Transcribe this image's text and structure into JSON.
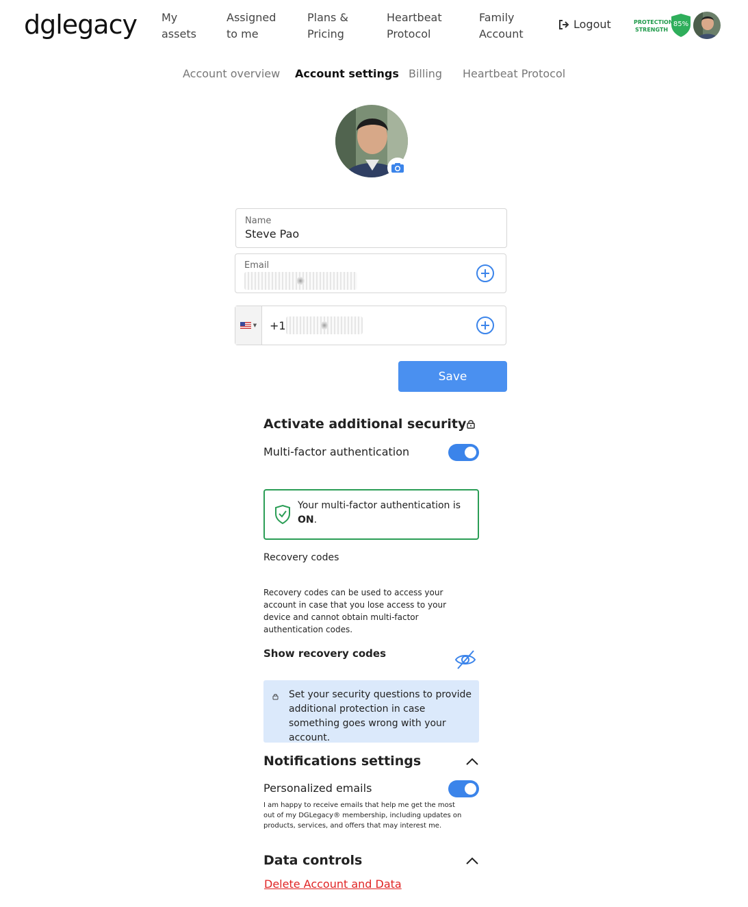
{
  "brand": {
    "logo_text": "dglegacy"
  },
  "nav": {
    "items": [
      {
        "line1": "My",
        "line2": "assets"
      },
      {
        "line1": "Assigned",
        "line2": "to me"
      },
      {
        "line1": "Plans &",
        "line2": "Pricing"
      },
      {
        "line1": "Heartbeat",
        "line2": "Protocol"
      },
      {
        "line1": "Family",
        "line2": "Account"
      }
    ],
    "logout_label": "Logout",
    "protection_line1": "PROTECTION",
    "protection_line2": "STRENGTH",
    "protection_value": "85%"
  },
  "subnav": {
    "tabs": [
      {
        "label": "Account overview",
        "active": false
      },
      {
        "label": "Account settings",
        "active": true
      },
      {
        "label": "Billing",
        "active": false
      },
      {
        "label": "Heartbeat Protocol",
        "active": false
      }
    ]
  },
  "form": {
    "name_label": "Name",
    "name_value": "Steve Pao",
    "email_label": "Email",
    "phone_prefix": "+1",
    "save_label": "Save"
  },
  "security": {
    "title": "Activate additional security",
    "mfa_label": "Multi-factor authentication",
    "mfa_enabled": true,
    "mfa_status_text": "Your multi-factor authentication is",
    "mfa_status_value": "ON",
    "mfa_status_suffix": ".",
    "recovery_title": "Recovery codes",
    "recovery_desc": "Recovery codes can be used to access your account in case that you lose access to your device and cannot obtain multi-factor authentication codes.",
    "show_codes_label": "Show recovery codes",
    "questions_info": "Set your security questions to provide additional protection in case something goes wrong with your account."
  },
  "notifications": {
    "title": "Notifications settings",
    "personalized_label": "Personalized emails",
    "personalized_enabled": true,
    "personalized_desc": "I am happy to receive emails that help me get the most out of my DGLegacy® membership, including updates on products, services, and offers that may interest me."
  },
  "data_controls": {
    "title": "Data controls",
    "delete_label": "Delete Account and Data"
  },
  "colors": {
    "primary": "#4a90f0",
    "success": "#2a9d55",
    "danger": "#e02424",
    "info_bg": "#dbe9fb"
  }
}
